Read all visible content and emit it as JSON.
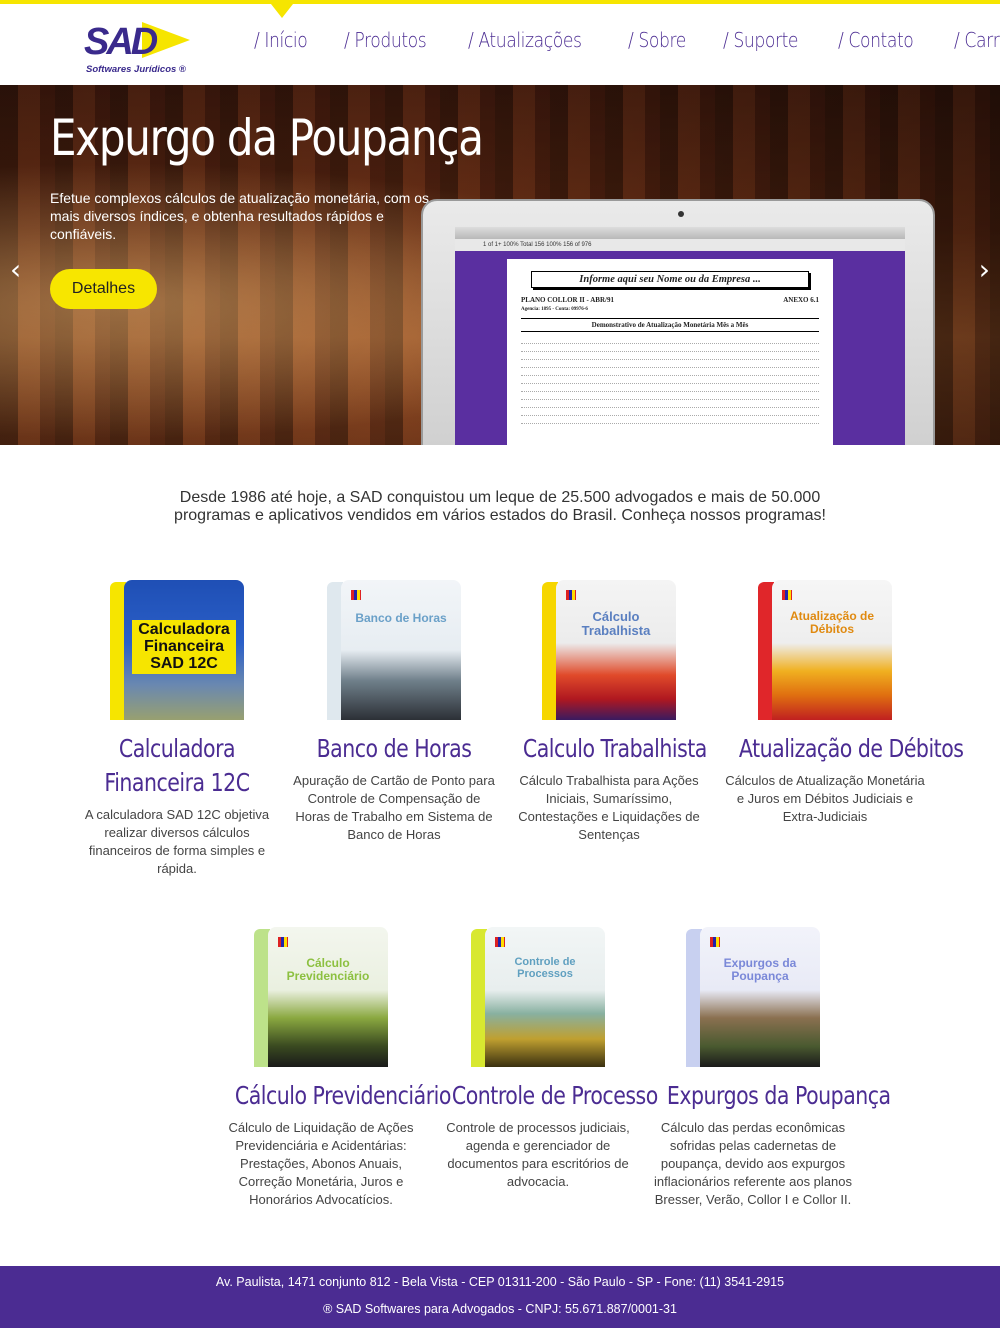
{
  "brand": {
    "logo_text": "SAD",
    "tagline": "Softwares Jurídicos ®",
    "colors": {
      "primary": "#4b2c92",
      "accent": "#f6e500",
      "text": "#333333"
    }
  },
  "nav": {
    "items": [
      {
        "label": "/ Início"
      },
      {
        "label": "/ Produtos"
      },
      {
        "label": "/ Atualizações"
      },
      {
        "label": "/ Sobre"
      },
      {
        "label": "/ Suporte"
      },
      {
        "label": "/ Contato"
      },
      {
        "label": "/ Carrinho"
      }
    ]
  },
  "hero": {
    "title": "Expurgo da Poupança",
    "text": "Efetue complexos cálculos de atualização monetária, com os mais diversos índices, e obtenha resultados rápidos e confiáveis.",
    "button_label": "Detalhes",
    "prev_icon": "chevron-left-icon",
    "next_icon": "chevron-right-icon",
    "prev_glyph": "‹",
    "next_glyph": "›",
    "screen": {
      "toolbar": "1 of 1+    100%    Total 156    100%    156 of 976",
      "doc_header": "Informe aqui seu Nome ou da Empresa ...",
      "plan": "PLANO COLLOR II - ABR/91",
      "annex": "ANEXO 6.1",
      "account": "Agencia: 1895 - Conta: 09976-6",
      "doc_title": "Demonstrativo de Atualização Monetária Mês a Mês"
    }
  },
  "intro": {
    "line1": "Desde 1986 até hoje, a SAD conquistou um leque de 25.500 advogados e mais de 50.000",
    "line2": "programas e aplicativos vendidos em vários estados do Brasil. Conheça nossos programas!"
  },
  "products": [
    {
      "title": "Calculadora Financeira 12C",
      "box_label": "Calculadora Financeira SAD 12C",
      "desc": "A calculadora SAD 12C objetiva realizar diversos cálculos financeiros de forma simples e rápida."
    },
    {
      "title": "Banco de Horas",
      "box_label": "Banco de Horas",
      "desc": "Apuração de Cartão de Ponto para Controle de Compensação de Horas de Trabalho em Sistema de Banco de Horas"
    },
    {
      "title": "Calculo Trabalhista",
      "box_label": "Cálculo Trabalhista",
      "desc": "Cálculo Trabalhista para Ações Iniciais, Sumaríssimo, Contestações e Liquidações de Sentenças"
    },
    {
      "title": "Atualização de Débitos",
      "box_label": "Atualização de Débitos",
      "desc": "Cálculos de Atualização Monetária e Juros em Débitos Judiciais e Extra-Judiciais"
    },
    {
      "title": "Cálculo Previdenciário",
      "box_label": "Cálculo Previdenciário",
      "desc": "Cálculo de Liquidação de Ações Previdenciária e Acidentárias: Prestações, Abonos Anuais, Correção Monetária, Juros e Honorários Advocatícios."
    },
    {
      "title": "Controle de Processo",
      "box_label": "Controle de Processos",
      "desc": "Controle de processos judiciais, agenda e gerenciador de documentos para escritórios de advocacia."
    },
    {
      "title": "Expurgos da Poupança",
      "box_label": "Expurgos da Poupança",
      "desc": "Cálculo das perdas econômicas sofridas pelas cadernetas de poupança, devido aos expurgos inflacionários referente aos planos Bresser, Verão, Collor I e Collor II."
    }
  ],
  "footer": {
    "address": "Av. Paulista, 1471 conjunto 812 - Bela Vista - CEP 01311-200 - São Paulo - SP - Fone: (11) 3541-2915",
    "copyright": "® SAD Softwares para Advogados - CNPJ: 55.671.887/0001-31"
  }
}
